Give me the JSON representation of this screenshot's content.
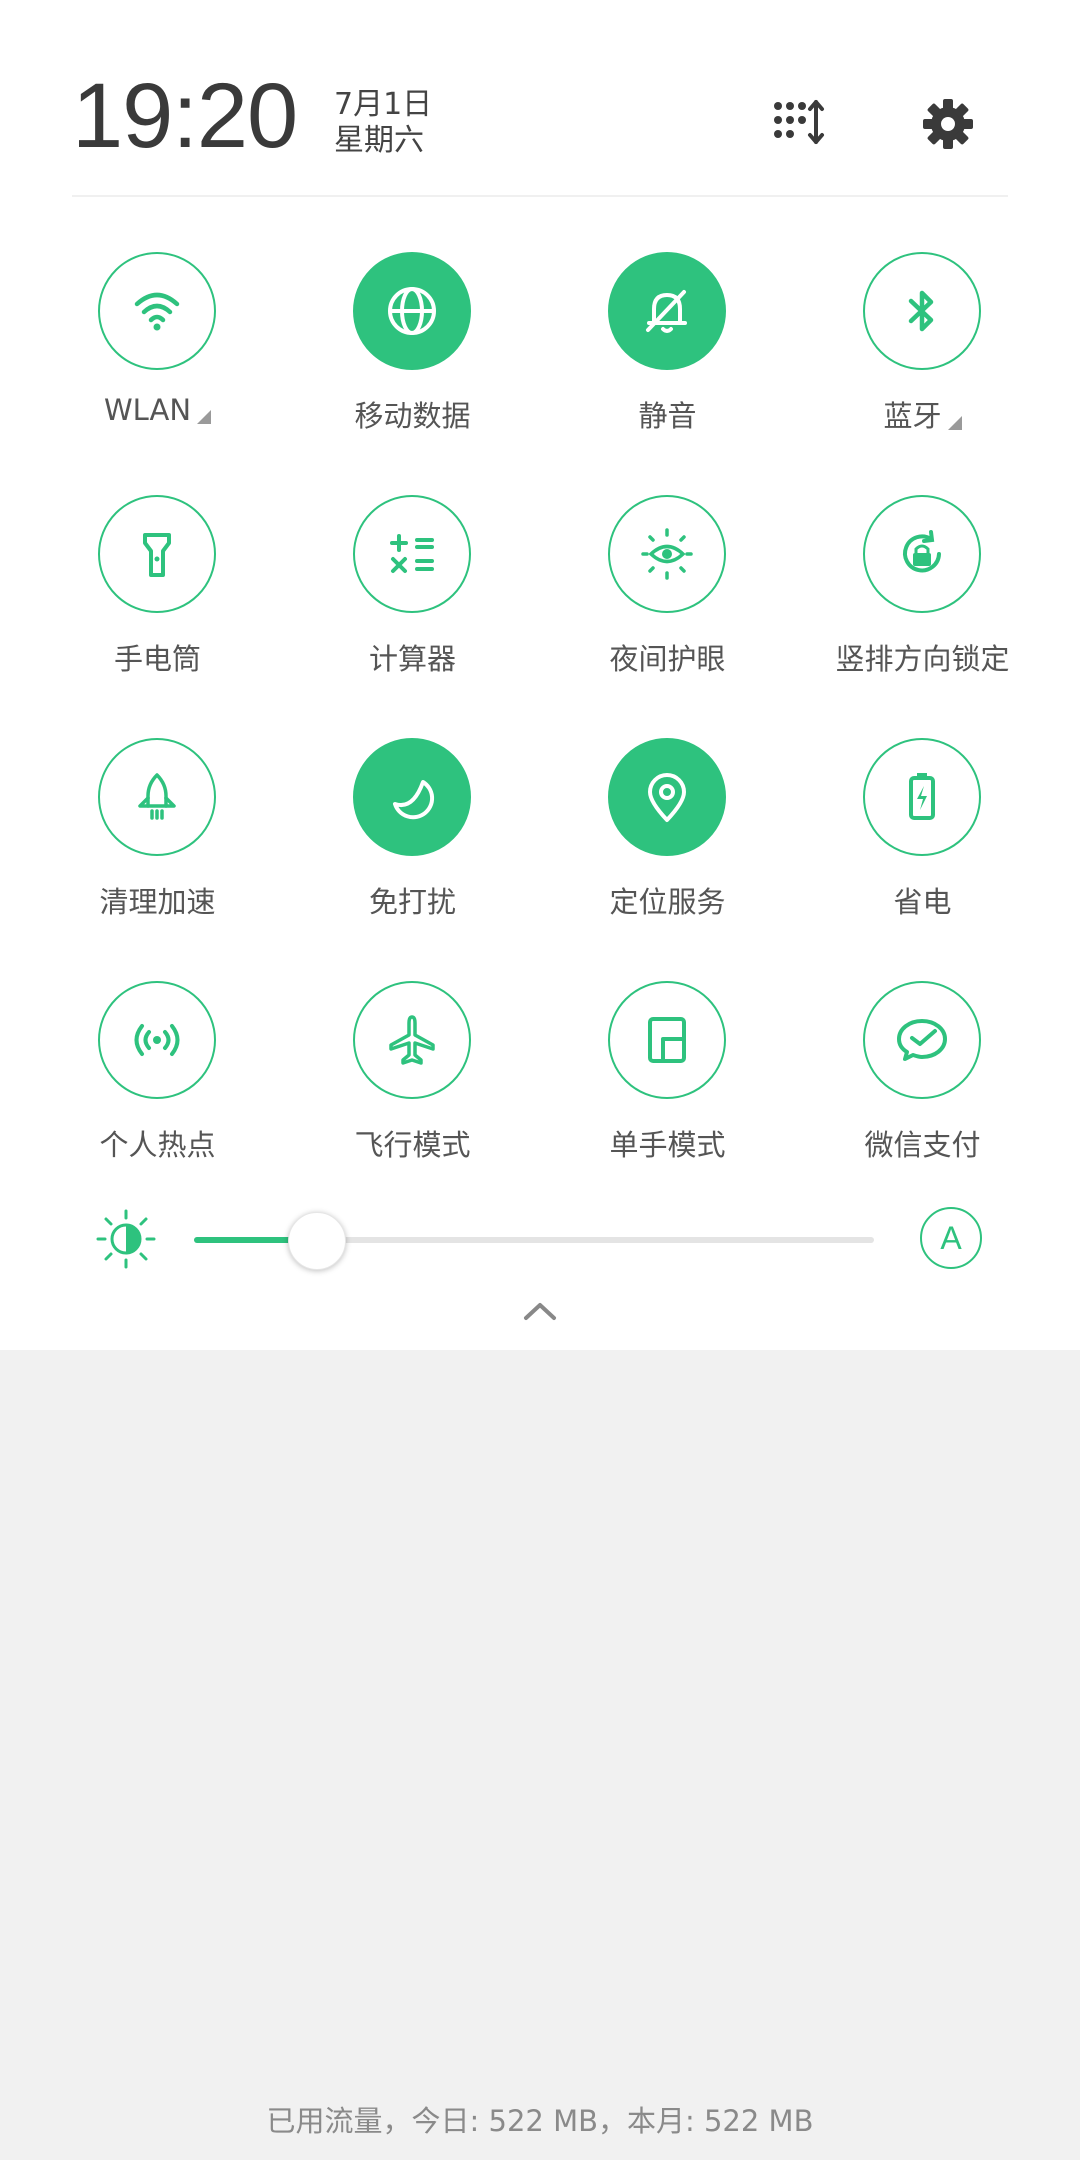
{
  "header": {
    "time": "19:20",
    "date": "7月1日",
    "weekday": "星期六",
    "edit_icon": "edit-tiles-icon",
    "settings_icon": "gear-icon"
  },
  "colors": {
    "accent": "#2ec27e",
    "panel_bg": "#ffffff",
    "shade_bg": "#f1f1f1"
  },
  "tiles": [
    {
      "label": "WLAN",
      "icon": "wifi-icon",
      "active": false,
      "expandable": true
    },
    {
      "label": "移动数据",
      "icon": "globe-icon",
      "active": true,
      "expandable": false
    },
    {
      "label": "静音",
      "icon": "bell-off-icon",
      "active": true,
      "expandable": false
    },
    {
      "label": "蓝牙",
      "icon": "bluetooth-icon",
      "active": false,
      "expandable": true
    },
    {
      "label": "手电筒",
      "icon": "flashlight-icon",
      "active": false,
      "expandable": false
    },
    {
      "label": "计算器",
      "icon": "calculator-icon",
      "active": false,
      "expandable": false
    },
    {
      "label": "夜间护眼",
      "icon": "eye-care-icon",
      "active": false,
      "expandable": false
    },
    {
      "label": "竖排方向锁定",
      "icon": "rotation-lock-icon",
      "active": false,
      "expandable": false
    },
    {
      "label": "清理加速",
      "icon": "rocket-icon",
      "active": false,
      "expandable": false
    },
    {
      "label": "免打扰",
      "icon": "moon-icon",
      "active": true,
      "expandable": false
    },
    {
      "label": "定位服务",
      "icon": "location-pin-icon",
      "active": true,
      "expandable": false
    },
    {
      "label": "省电",
      "icon": "battery-saver-icon",
      "active": false,
      "expandable": false
    },
    {
      "label": "个人热点",
      "icon": "hotspot-icon",
      "active": false,
      "expandable": false
    },
    {
      "label": "飞行模式",
      "icon": "airplane-icon",
      "active": false,
      "expandable": false
    },
    {
      "label": "单手模式",
      "icon": "one-hand-mode-icon",
      "active": false,
      "expandable": false
    },
    {
      "label": "微信支付",
      "icon": "wechat-pay-icon",
      "active": false,
      "expandable": false
    }
  ],
  "brightness": {
    "level": 0.18,
    "auto_label": "A"
  },
  "footer": {
    "data_usage": "已用流量，今日: 522 MB，本月: 522 MB"
  }
}
